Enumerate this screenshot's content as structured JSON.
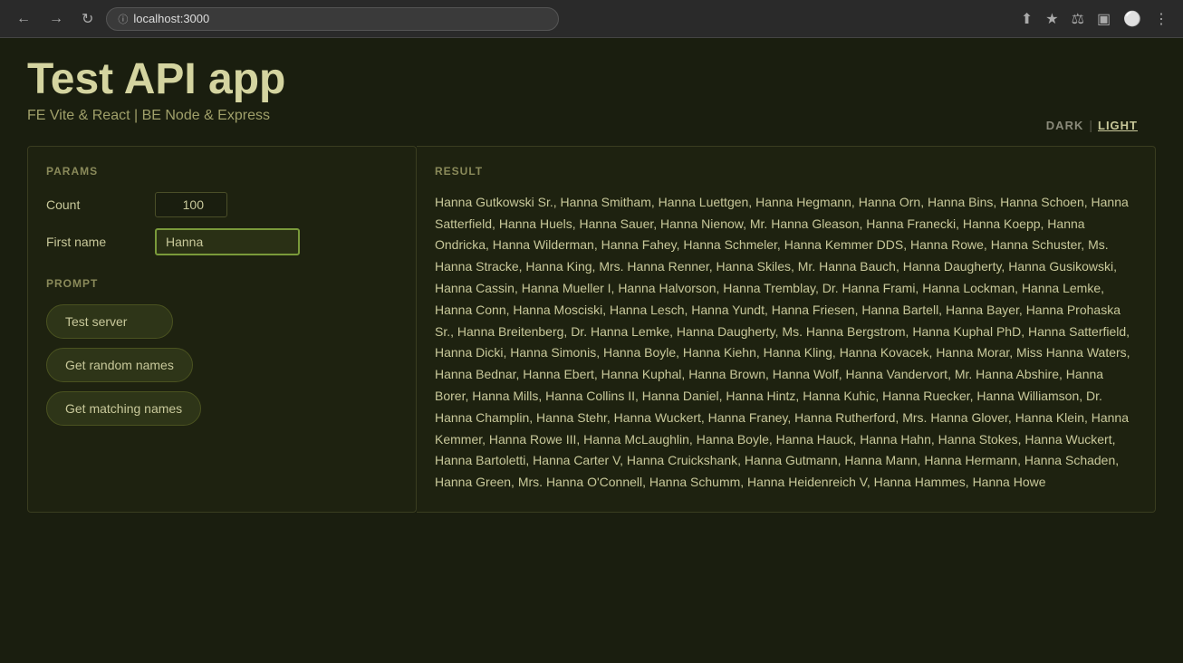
{
  "browser": {
    "url": "localhost:3000",
    "nav": {
      "back": "←",
      "forward": "→",
      "reload": "↻"
    }
  },
  "app": {
    "title": "Test API app",
    "subtitle": "FE Vite & React | BE Node & Express"
  },
  "theme": {
    "dark_label": "DARK",
    "light_label": "LIGHT"
  },
  "params": {
    "section_label": "PARAMS",
    "count_label": "Count",
    "count_value": "100",
    "first_name_label": "First name",
    "first_name_value": "Hanna"
  },
  "prompt": {
    "section_label": "PROMPT",
    "buttons": [
      {
        "id": "test-server",
        "label": "Test server"
      },
      {
        "id": "get-random-names",
        "label": "Get random names"
      },
      {
        "id": "get-matching-names",
        "label": "Get matching names"
      }
    ]
  },
  "result": {
    "section_label": "RESULT",
    "text": "Hanna Gutkowski Sr., Hanna Smitham, Hanna Luettgen, Hanna Hegmann, Hanna Orn, Hanna Bins, Hanna Schoen, Hanna Satterfield, Hanna Huels, Hanna Sauer, Hanna Nienow, Mr. Hanna Gleason, Hanna Franecki, Hanna Koepp, Hanna Ondricka, Hanna Wilderman, Hanna Fahey, Hanna Schmeler, Hanna Kemmer DDS, Hanna Rowe, Hanna Schuster, Ms. Hanna Stracke, Hanna King, Mrs. Hanna Renner, Hanna Skiles, Mr. Hanna Bauch, Hanna Daugherty, Hanna Gusikowski, Hanna Cassin, Hanna Mueller I, Hanna Halvorson, Hanna Tremblay, Dr. Hanna Frami, Hanna Lockman, Hanna Lemke, Hanna Conn, Hanna Mosciski, Hanna Lesch, Hanna Yundt, Hanna Friesen, Hanna Bartell, Hanna Bayer, Hanna Prohaska Sr., Hanna Breitenberg, Dr. Hanna Lemke, Hanna Daugherty, Ms. Hanna Bergstrom, Hanna Kuphal PhD, Hanna Satterfield, Hanna Dicki, Hanna Simonis, Hanna Boyle, Hanna Kiehn, Hanna Kling, Hanna Kovacek, Hanna Morar, Miss Hanna Waters, Hanna Bednar, Hanna Ebert, Hanna Kuphal, Hanna Brown, Hanna Wolf, Hanna Vandervort, Mr. Hanna Abshire, Hanna Borer, Hanna Mills, Hanna Collins II, Hanna Daniel, Hanna Hintz, Hanna Kuhic, Hanna Ruecker, Hanna Williamson, Dr. Hanna Champlin, Hanna Stehr, Hanna Wuckert, Hanna Franey, Hanna Rutherford, Mrs. Hanna Glover, Hanna Klein, Hanna Kemmer, Hanna Rowe III, Hanna McLaughlin, Hanna Boyle, Hanna Hauck, Hanna Hahn, Hanna Stokes, Hanna Wuckert, Hanna Bartoletti, Hanna Carter V, Hanna Cruickshank, Hanna Gutmann, Hanna Mann, Hanna Hermann, Hanna Schaden, Hanna Green, Mrs. Hanna O'Connell, Hanna Schumm, Hanna Heidenreich V, Hanna Hammes, Hanna Howe"
  }
}
